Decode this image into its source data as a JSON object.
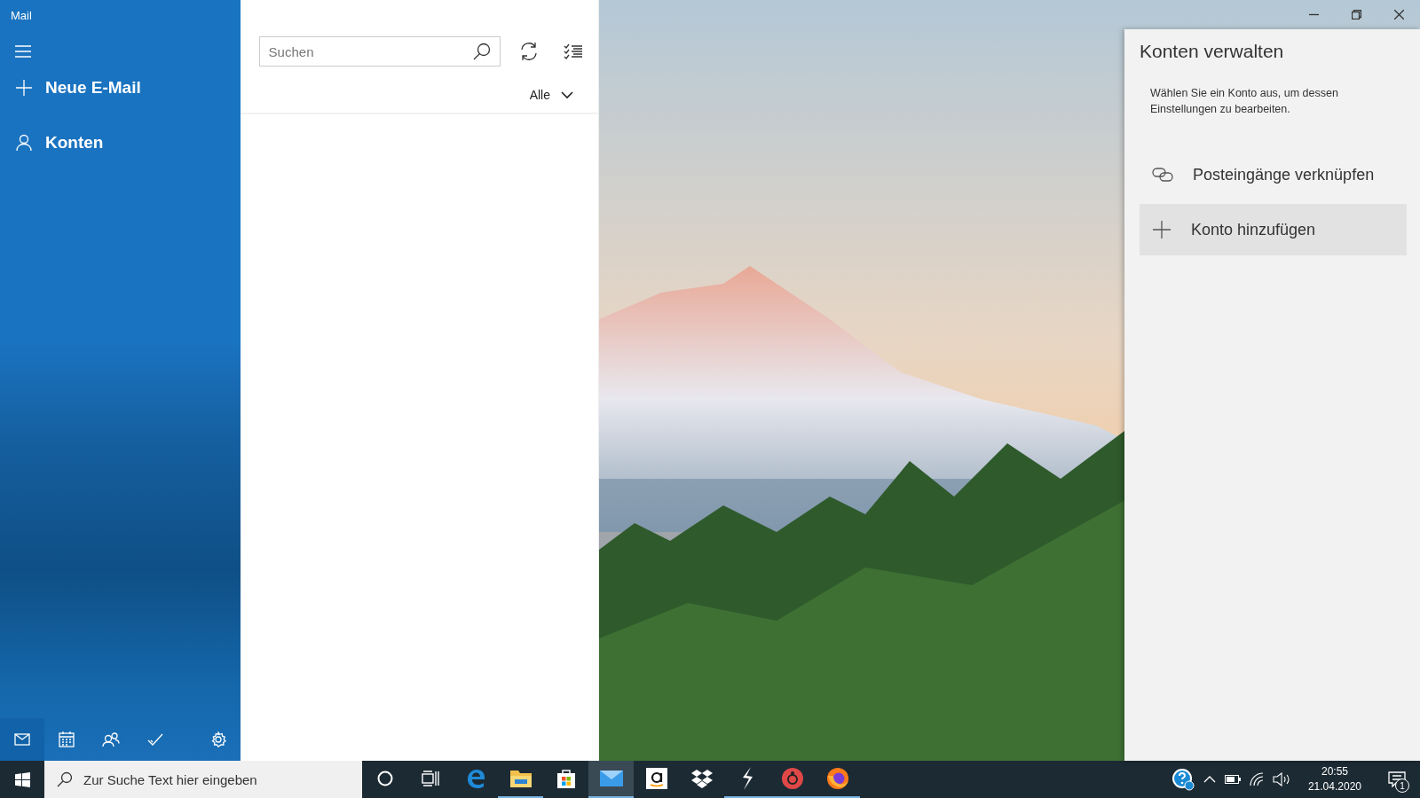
{
  "window": {
    "title": "Mail"
  },
  "sidebar": {
    "items": [
      {
        "kind": "plus",
        "label": "Neue E-Mail"
      },
      {
        "kind": "person",
        "label": "Konten"
      }
    ],
    "bottom_nav": [
      {
        "kind": "mail",
        "selected": true
      },
      {
        "kind": "calendar",
        "selected": false
      },
      {
        "kind": "people",
        "selected": false
      },
      {
        "kind": "todo",
        "selected": false
      },
      {
        "kind": "settings",
        "selected": false
      }
    ]
  },
  "message_list": {
    "search": {
      "placeholder": "Suchen"
    },
    "filter": "Alle"
  },
  "flyout": {
    "title": "Konten verwalten",
    "description": "Wählen Sie ein Konto aus, um dessen Einstellungen zu bearbeiten.",
    "actions": [
      {
        "kind": "link",
        "label": "Posteingänge verknüpfen",
        "selected": false
      },
      {
        "kind": "plus",
        "label": "Konto hinzufügen",
        "selected": true
      }
    ]
  },
  "taskbar": {
    "search": {
      "placeholder": "Zur Suche Text hier eingeben"
    },
    "apps": [
      {
        "kind": "cortana",
        "running": false,
        "selected": false
      },
      {
        "kind": "taskview",
        "running": false,
        "selected": false
      },
      {
        "kind": "edge",
        "running": false,
        "selected": false
      },
      {
        "kind": "explorer",
        "running": true,
        "selected": false
      },
      {
        "kind": "store",
        "running": false,
        "selected": false
      },
      {
        "kind": "mail",
        "running": true,
        "selected": true
      },
      {
        "kind": "amazon",
        "running": false,
        "selected": false
      },
      {
        "kind": "dropbox",
        "running": false,
        "selected": false
      },
      {
        "kind": "bolt",
        "running": true,
        "selected": false
      },
      {
        "kind": "round-app",
        "running": true,
        "selected": false
      },
      {
        "kind": "firefox",
        "running": true,
        "selected": false
      }
    ],
    "clock": {
      "time": "20:55",
      "date": "21.04.2020"
    },
    "notification_count": "1"
  }
}
